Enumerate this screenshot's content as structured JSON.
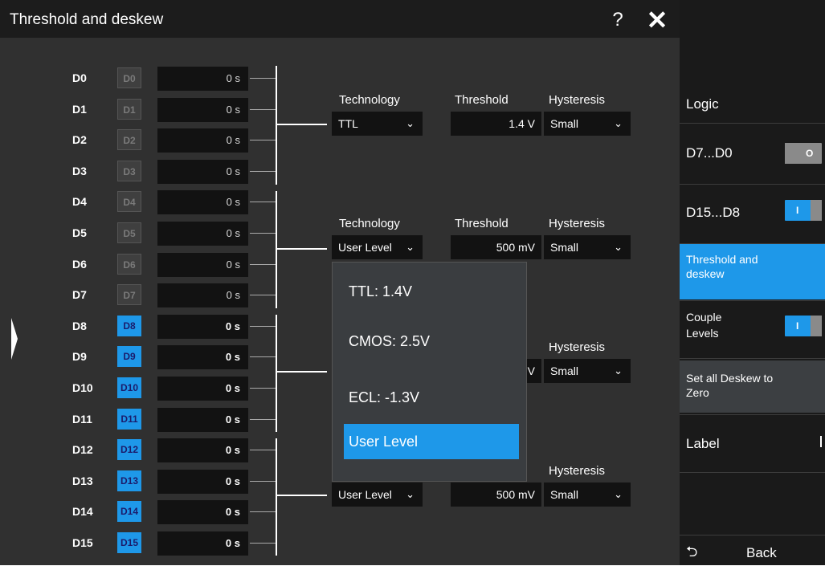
{
  "window": {
    "title": "Threshold and deskew",
    "help_label": "?",
    "close_label": "✕"
  },
  "channels": [
    {
      "name": "D0",
      "badge": "D0",
      "deskew": "0 s",
      "active": false
    },
    {
      "name": "D1",
      "badge": "D1",
      "deskew": "0 s",
      "active": false
    },
    {
      "name": "D2",
      "badge": "D2",
      "deskew": "0 s",
      "active": false
    },
    {
      "name": "D3",
      "badge": "D3",
      "deskew": "0 s",
      "active": false
    },
    {
      "name": "D4",
      "badge": "D4",
      "deskew": "0 s",
      "active": false
    },
    {
      "name": "D5",
      "badge": "D5",
      "deskew": "0 s",
      "active": false
    },
    {
      "name": "D6",
      "badge": "D6",
      "deskew": "0 s",
      "active": false
    },
    {
      "name": "D7",
      "badge": "D7",
      "deskew": "0 s",
      "active": false
    },
    {
      "name": "D8",
      "badge": "D8",
      "deskew": "0 s",
      "active": true
    },
    {
      "name": "D9",
      "badge": "D9",
      "deskew": "0 s",
      "active": true
    },
    {
      "name": "D10",
      "badge": "D10",
      "deskew": "0 s",
      "active": true
    },
    {
      "name": "D11",
      "badge": "D11",
      "deskew": "0 s",
      "active": true
    },
    {
      "name": "D12",
      "badge": "D12",
      "deskew": "0 s",
      "active": true
    },
    {
      "name": "D13",
      "badge": "D13",
      "deskew": "0 s",
      "active": true
    },
    {
      "name": "D14",
      "badge": "D14",
      "deskew": "0 s",
      "active": true
    },
    {
      "name": "D15",
      "badge": "D15",
      "deskew": "0 s",
      "active": true
    }
  ],
  "groups": [
    {
      "technology_label": "Technology",
      "technology": "TTL",
      "threshold_label": "Threshold",
      "threshold": "1.4 V",
      "hysteresis_label": "Hysteresis",
      "hysteresis": "Small"
    },
    {
      "technology_label": "Technology",
      "technology": "User Level",
      "threshold_label": "Threshold",
      "threshold": "500 mV",
      "hysteresis_label": "Hysteresis",
      "hysteresis": "Small"
    },
    {
      "hysteresis_label": "Hysteresis",
      "hysteresis": "Small",
      "threshold_partial": "V"
    },
    {
      "technology": "User Level",
      "threshold": "500 mV",
      "hysteresis_label": "Hysteresis",
      "hysteresis": "Small"
    }
  ],
  "dropdown_chevron": "⌵",
  "technology_popup": {
    "options": [
      "TTL: 1.4V",
      "CMOS: 2.5V",
      "ECL: -1.3V",
      "User Level"
    ],
    "selected": "User Level"
  },
  "sidebar": {
    "heading": "Logic",
    "items": [
      {
        "label": "D7...D0",
        "toggle": "off"
      },
      {
        "label": "D15...D8",
        "toggle": "on"
      },
      {
        "label": "Threshold and deskew"
      },
      {
        "label": "Couple Levels",
        "toggle": "on"
      },
      {
        "label": "Set all Deskew to Zero"
      },
      {
        "label": "Label"
      }
    ],
    "back_label": "Back",
    "accent_color": "#1e98e9"
  }
}
